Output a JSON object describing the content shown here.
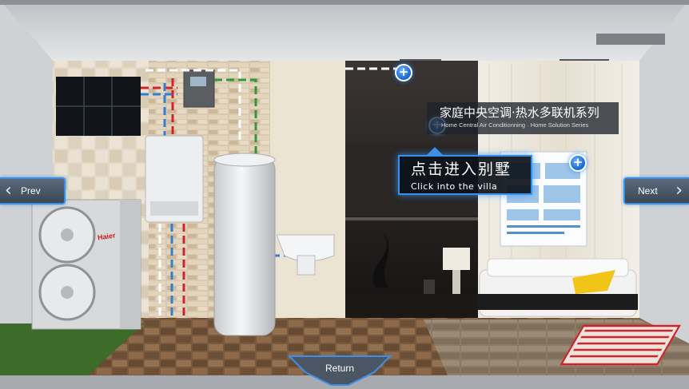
{
  "scene": {
    "title_cn": "家庭中央空调·热水多联机系列",
    "title_en": "Home Central Air Conditionning · Home Solution Series",
    "brand": "Haier"
  },
  "navigation": {
    "prev_label": "Prev",
    "next_label": "Next",
    "return_label": "Return"
  },
  "villa_tip": {
    "title_cn": "点击进入别墅",
    "title_en": "Click into the villa"
  },
  "colors": {
    "accent_blue": "#3d8ee6",
    "hot_pipe": "#d2232a",
    "cold_pipe": "#2f7fd8",
    "grass": "#3c6b2a"
  },
  "icons": {
    "hotspot": "plus-circle-icon",
    "prev": "chevron-left-icon",
    "next": "chevron-right-icon",
    "return": "down-arrow-icon"
  }
}
